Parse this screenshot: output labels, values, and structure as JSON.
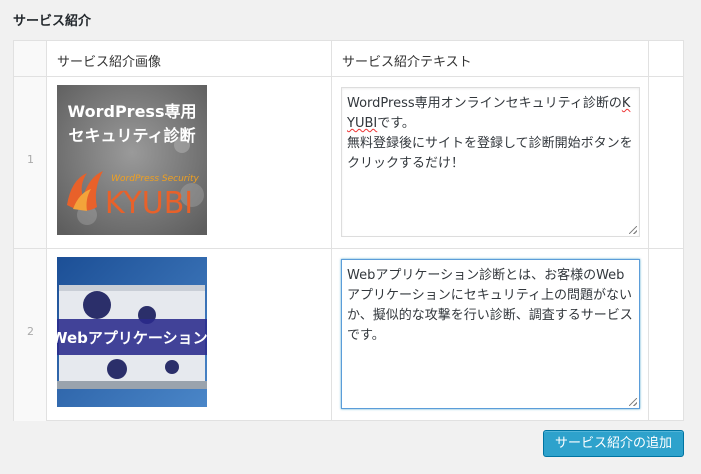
{
  "section": {
    "title": "サービス紹介"
  },
  "table": {
    "headers": {
      "image": "サービス紹介画像",
      "text": "サービス紹介テキスト"
    },
    "rows": [
      {
        "number": "1",
        "image": {
          "line1": "WordPress専用",
          "line2": "セキュリティ診断",
          "brand_small": "WordPress Security",
          "brand": "KYUBI"
        },
        "text_before": "WordPress専用オンラインセキュリティ診断の",
        "text_underlined": "KYUBI",
        "text_after": "です。\n無料登録後にサイトを登録して診断開始ボタンをクリックするだけ！"
      },
      {
        "number": "2",
        "image": {
          "banner": "Webアプリケーション診"
        },
        "text": "Webアプリケーション診断とは、お客様のWebアプリケーションにセキュリティ上の問題がないか、擬似的な攻撃を行い診断、調査するサービスです。"
      }
    ]
  },
  "actions": {
    "add_label": "サービス紹介の追加"
  }
}
